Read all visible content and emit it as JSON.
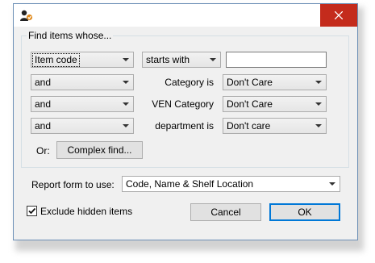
{
  "dialog": {
    "group_title": "Find items whose...",
    "rows": [
      {
        "field": "Item code",
        "operator": "starts with",
        "value": ""
      },
      {
        "conjunction": "and",
        "label": "Category is",
        "value": "Don't Care"
      },
      {
        "conjunction": "and",
        "label": "VEN Category",
        "value": "Don't Care"
      },
      {
        "conjunction": "and",
        "label": "department is",
        "value": "Don't care"
      }
    ],
    "or_label": "Or:",
    "complex_find_label": "Complex find...",
    "report_form_label": "Report form to use:",
    "report_form_value": "Code, Name & Shelf Location",
    "exclude_hidden_label": "Exclude hidden items",
    "exclude_hidden_checked": true,
    "cancel_label": "Cancel",
    "ok_label": "OK"
  },
  "colors": {
    "close_button": "#c42b1c",
    "default_button_border": "#0078d7",
    "window_border": "#6d90b7"
  },
  "icons": {
    "app": "app-user-icon",
    "close": "close-icon",
    "dropdown": "chevron-down-icon",
    "check": "checkmark-icon"
  }
}
